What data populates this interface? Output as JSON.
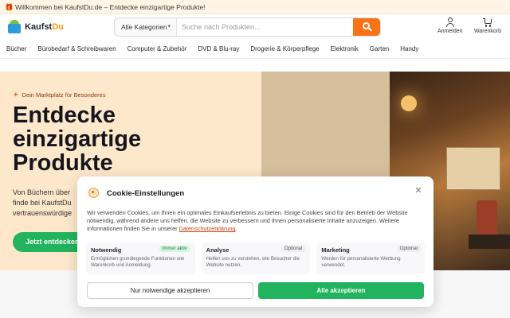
{
  "announcement": "🎁 Willkommen bei KaufstDu.de – Entdecke einzigartige Produkte!",
  "logo": {
    "name_a": "Kaufst",
    "name_b": "Du"
  },
  "search": {
    "category": "Alle Kategorien",
    "placeholder": "Suche nach Produkten...",
    "value": ""
  },
  "header_actions": {
    "login": "Anmelden",
    "cart": "Warenkorb"
  },
  "nav": [
    "Bücher",
    "Bürobedarf & Schreibwaren",
    "Computer & Zubehör",
    "DVD & Blu-ray",
    "Drogerie & Körperpflege",
    "Elektronik",
    "Garten",
    "Handy"
  ],
  "hero": {
    "tag": "Dein Marktplatz für Besonderes",
    "title_lines": [
      "Entdecke",
      "einzigartige",
      "Produkte"
    ],
    "subtitle_lines": [
      "Von Büchern über",
      "finde bei KaufstDu",
      "vertrauenswürdige"
    ],
    "cta": "Jetzt entdecken"
  },
  "cookie": {
    "title": "Cookie-Einstellungen",
    "text": "Wir verwenden Cookies, um Ihnen ein optimales Einkaufserlebnis zu bieten. Einige Cookies sind für den Betrieb der Website notwendig, während andere uns helfen, die Website zu verbessern und Ihnen personalisierte Inhalte anzuzeigen. Weitere Informationen finden Sie in unserer",
    "link": "Datenschutzerklärung",
    "options": [
      {
        "name": "Notwendig",
        "badge": "Immer aktiv",
        "desc": "Ermöglichen grundlegende Funktionen wie Warenkorb und Anmeldung."
      },
      {
        "name": "Analyse",
        "badge": "Optional",
        "desc": "Helfen uns zu verstehen, wie Besucher die Website nutzen."
      },
      {
        "name": "Marketing",
        "badge": "Optional",
        "desc": "Werden für personalisierte Werbung verwendet."
      }
    ],
    "btn_necessary": "Nur notwendige akzeptieren",
    "btn_all": "Alle akzeptieren"
  }
}
